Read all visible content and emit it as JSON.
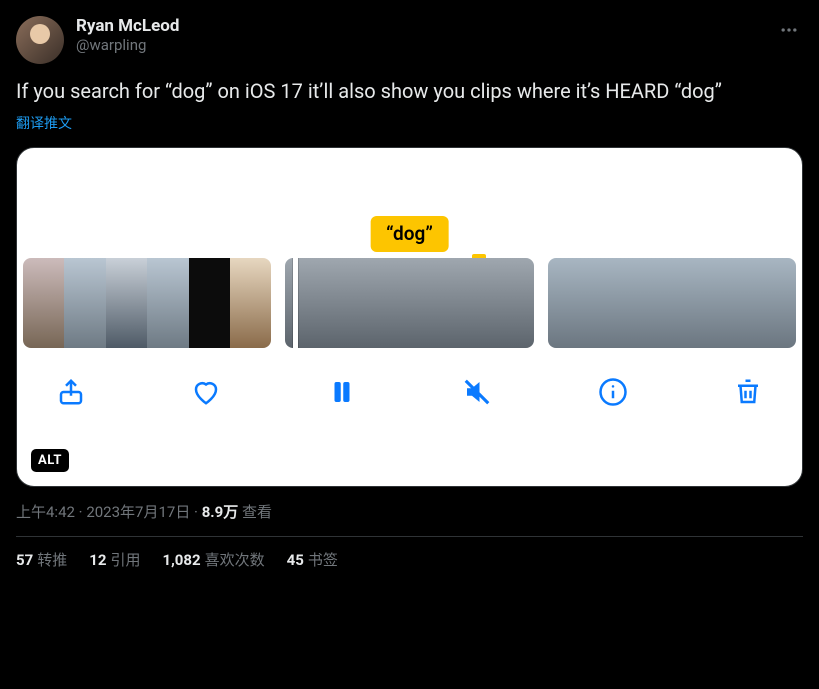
{
  "author": {
    "display_name": "Ryan McLeod",
    "handle": "@warpling"
  },
  "body_text": "If you search for “dog” on iOS 17 it’ll also show you clips where it’s HEARD “dog”",
  "translate_label": "翻译推文",
  "media": {
    "search_chip": "“dog”",
    "alt_badge": "ALT"
  },
  "meta": {
    "time": "上午4:42",
    "sep": " · ",
    "date": "2023年7月17日",
    "views_count": "8.9万",
    "views_label": " 查看"
  },
  "stats": {
    "retweets_count": "57",
    "retweets_label": "转推",
    "quotes_count": "12",
    "quotes_label": "引用",
    "likes_count": "1,082",
    "likes_label": "喜欢次数",
    "bookmarks_count": "45",
    "bookmarks_label": "书签"
  }
}
